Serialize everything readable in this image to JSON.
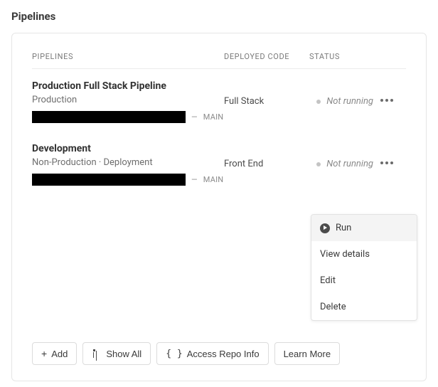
{
  "page": {
    "title": "Pipelines"
  },
  "headers": {
    "pipelines": "PIPELINES",
    "deployed_code": "DEPLOYED CODE",
    "status": "STATUS"
  },
  "rows": [
    {
      "name": "Production Full Stack Pipeline",
      "subtitle": "Production",
      "branch_sep": "—",
      "branch": "MAIN",
      "deployed_code": "Full Stack",
      "status": "Not running"
    },
    {
      "name": "Development",
      "subtitle": "Non-Production  ·  Deployment",
      "branch_sep": "—",
      "branch": "MAIN",
      "deployed_code": "Front End",
      "status": "Not running"
    }
  ],
  "menu": {
    "run": "Run",
    "view_details": "View details",
    "edit": "Edit",
    "delete": "Delete"
  },
  "footer": {
    "add": "Add",
    "show_all": "Show All",
    "repo_info": "Access Repo Info",
    "learn_more": "Learn More"
  }
}
